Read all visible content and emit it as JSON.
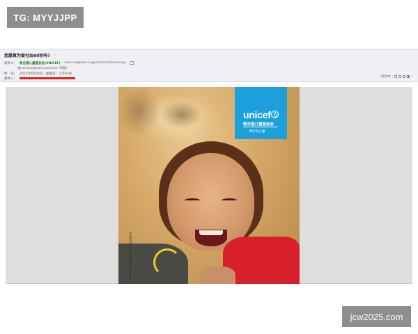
{
  "watermarks": {
    "top_left": "TG: MYYJJPP",
    "bottom_right": "jcw2025.com"
  },
  "email": {
    "subject": "您愿意为爱付出60秒吗?",
    "from_label": "发件人：",
    "sender_name": "联合国儿童基金会(UNICEF)",
    "sender_email": "<service@care.supportunicefchina.org>",
    "on_behalf": "(由 service@care.unicef.cn 代发)",
    "time_label": "时　间：",
    "time_value": "2022年4月24日（星期日）上午8:40",
    "to_label": "收件人：",
    "toolbar": {
      "plain_text": "纯文本"
    }
  },
  "poster": {
    "logo_word": "unicef",
    "logo_cn": "联合国儿童基金会",
    "tagline": "携手为儿童",
    "photo_credit": "©UNICEF/China/2015/Liu Manman"
  },
  "colors": {
    "header_bg": "#efeff4",
    "unicef_blue": "#1ca0dc",
    "sender_green": "#2a7a2a",
    "redaction_red": "#e0201a",
    "body_gray": "#dedede"
  }
}
